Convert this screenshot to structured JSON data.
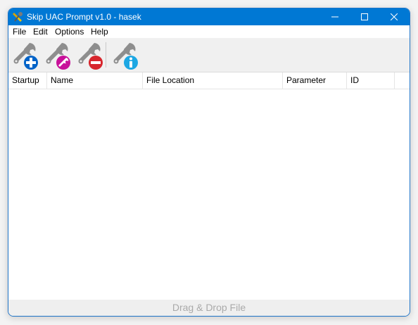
{
  "window": {
    "title": "Skip UAC Prompt v1.0 - hasek"
  },
  "menubar": {
    "items": [
      "File",
      "Edit",
      "Options",
      "Help"
    ]
  },
  "toolbar": {
    "buttons": [
      {
        "name": "add",
        "icon": "wrench-add-icon",
        "badge_color": "#0063c8"
      },
      {
        "name": "edit",
        "icon": "wrench-edit-icon",
        "badge_color": "#c8119a"
      },
      {
        "name": "remove",
        "icon": "wrench-remove-icon",
        "badge_color": "#d7262d"
      },
      {
        "name": "info",
        "icon": "wrench-info-icon",
        "badge_color": "#1da7e3"
      }
    ]
  },
  "list": {
    "columns": [
      "Startup",
      "Name",
      "File Location",
      "Parameter",
      "ID"
    ],
    "rows": []
  },
  "dropzone": {
    "label": "Drag & Drop File"
  },
  "colors": {
    "titlebar": "#0078d4",
    "window_border": "#1e74c8"
  }
}
